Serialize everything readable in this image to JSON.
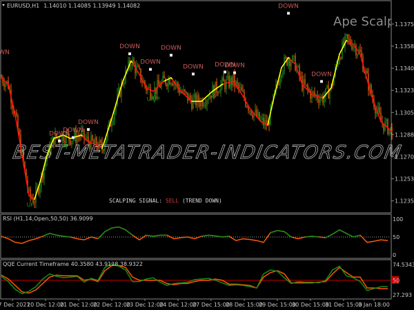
{
  "header": {
    "symbol": "EURUSD,H1",
    "ohlc": "1.14010 1.14085 1.13949 1.14082"
  },
  "indicator_title": "Ape Scalpin",
  "signal": {
    "prefix": "SCALPING SIGNAL: ",
    "value": "SELL",
    "suffix": " (TREND DOWN)"
  },
  "watermark": "BEST-METATRADER-INDICATORS.COM",
  "colors": {
    "bull": "#1f8a1f",
    "bear": "#e0600f",
    "trend_down": "#ff1010",
    "trend_up": "#ffff00",
    "down_label": "#c85a5a",
    "up_label": "#1f9a1f",
    "grid": "#8a8a8a"
  },
  "chart_data": [
    {
      "type": "candlestick",
      "title": "EURUSD,H1",
      "price_ticks": [
        "1.13755",
        "1.13580",
        "1.13405",
        "1.13230",
        "1.13055",
        "1.12880",
        "1.12705",
        "1.12530",
        "1.12355"
      ],
      "price_tick_values": [
        1.13755,
        1.1358,
        1.13405,
        1.1323,
        1.13055,
        1.1288,
        1.12705,
        1.1253,
        1.12355
      ],
      "ylim": [
        1.1226,
        1.1394
      ],
      "xlim": [
        0,
        283
      ],
      "time_ticks": [
        {
          "bar": 8,
          "label": "17 Dec 2021"
        },
        {
          "bar": 32,
          "label": "20 Dec 12:00"
        },
        {
          "bar": 56,
          "label": "21 Dec 12:00"
        },
        {
          "bar": 80,
          "label": "22 Dec 12:00"
        },
        {
          "bar": 104,
          "label": "23 Dec 12:00"
        },
        {
          "bar": 128,
          "label": "24 Dec 12:00"
        },
        {
          "bar": 152,
          "label": "27 Dec 15:00"
        },
        {
          "bar": 176,
          "label": "28 Dec 15:00"
        },
        {
          "bar": 200,
          "label": "29 Dec 15:00"
        },
        {
          "bar": 224,
          "label": "30 Dec 15:00"
        },
        {
          "bar": 248,
          "label": "31 Dec 15:00"
        },
        {
          "bar": 270,
          "label": "3 Jan 18:00"
        }
      ],
      "trend_line": {
        "bar": [
          0,
          5,
          10,
          15,
          20,
          24,
          28,
          33,
          38,
          45,
          50,
          58,
          63,
          70,
          73,
          80,
          88,
          94,
          100,
          105,
          110,
          118,
          123,
          130,
          138,
          145,
          153,
          160,
          168,
          173,
          180,
          188,
          193,
          198,
          203,
          208,
          213,
          218,
          225,
          233,
          239,
          245,
          250,
          255,
          260,
          268,
          275,
          283
        ],
        "price": [
          1.1333,
          1.13277,
          1.13036,
          1.12716,
          1.12395,
          1.12368,
          1.12502,
          1.12716,
          1.12849,
          1.12876,
          1.12849,
          1.12876,
          1.12823,
          1.12796,
          1.12769,
          1.13009,
          1.13303,
          1.13463,
          1.13356,
          1.1325,
          1.13223,
          1.13303,
          1.1333,
          1.13223,
          1.13143,
          1.13143,
          1.13223,
          1.13277,
          1.13303,
          1.13223,
          1.13089,
          1.12983,
          1.12956,
          1.13196,
          1.1341,
          1.1349,
          1.13437,
          1.13277,
          1.13196,
          1.13169,
          1.1325,
          1.13517,
          1.13624,
          1.13597,
          1.13517,
          1.13196,
          1.12983,
          1.12903
        ],
        "up_segments": [
          [
            24,
            58
          ],
          [
            73,
            94
          ],
          [
            118,
            123
          ],
          [
            138,
            160
          ],
          [
            193,
            208
          ],
          [
            233,
            250
          ]
        ]
      },
      "labels": [
        {
          "text": "WN",
          "bar": 2,
          "price": 1.13516,
          "kind": "down"
        },
        {
          "text": "DOWN",
          "bar": 42,
          "price": 1.12873,
          "kind": "down"
        },
        {
          "text": "DOWN",
          "bar": 52,
          "price": 1.129,
          "kind": "down"
        },
        {
          "text": "DOWN",
          "bar": 63,
          "price": 1.12964,
          "kind": "down"
        },
        {
          "text": "DOWN",
          "bar": 93,
          "price": 1.13563,
          "kind": "down"
        },
        {
          "text": "DOWN",
          "bar": 108,
          "price": 1.1344,
          "kind": "down"
        },
        {
          "text": "DOWN",
          "bar": 123,
          "price": 1.13552,
          "kind": "down"
        },
        {
          "text": "DOWN",
          "bar": 139,
          "price": 1.13403,
          "kind": "down"
        },
        {
          "text": "DOWN",
          "bar": 162,
          "price": 1.13419,
          "kind": "down"
        },
        {
          "text": "DOWN",
          "bar": 169,
          "price": 1.13413,
          "kind": "down"
        },
        {
          "text": "DOWN",
          "bar": 208,
          "price": 1.13884,
          "kind": "down"
        },
        {
          "text": "DOWN",
          "bar": 232,
          "price": 1.13344,
          "kind": "down"
        },
        {
          "text": "UP",
          "bar": 21,
          "price": 1.12309,
          "kind": "up"
        },
        {
          "text": "UP",
          "bar": 46,
          "price": 1.12773,
          "kind": "up"
        },
        {
          "text": "UP",
          "bar": 108,
          "price": 1.13146,
          "kind": "up"
        },
        {
          "text": "UP",
          "bar": 112,
          "price": 1.13146,
          "kind": "up"
        }
      ]
    },
    {
      "type": "line",
      "title": "RSI (H1,14,Open,50,50) 36.9099",
      "y_ticks": [
        "100",
        "50",
        "0"
      ],
      "ylim": [
        0,
        100
      ],
      "level": 50,
      "x_step_bars": 5,
      "series": [
        {
          "name": "RSI",
          "values": [
            52,
            45,
            35,
            32,
            40,
            45,
            52,
            60,
            55,
            52,
            50,
            45,
            42,
            50,
            45,
            65,
            75,
            78,
            70,
            55,
            42,
            55,
            52,
            55,
            55,
            45,
            48,
            50,
            45,
            52,
            55,
            53,
            50,
            52,
            40,
            45,
            43,
            40,
            35,
            62,
            68,
            65,
            50,
            45,
            50,
            52,
            50,
            48,
            58,
            70,
            60,
            50,
            55,
            35,
            38,
            42,
            40
          ]
        }
      ]
    },
    {
      "type": "line",
      "title": "QQE Current Timeframe 40.3580 43.9128 38.9322",
      "y_ticks": [
        "74.5343",
        "50",
        "27.293"
      ],
      "ylim": [
        27.293,
        74.5343
      ],
      "level": 50,
      "x_step_bars": 5,
      "series": [
        {
          "name": "QQE fast",
          "color": "#ff5a00",
          "values": [
            58,
            52,
            42,
            32,
            30,
            35,
            45,
            55,
            58,
            57,
            57,
            57,
            50,
            52,
            48,
            65,
            73,
            73,
            70,
            55,
            50,
            50,
            50,
            50,
            45,
            43,
            45,
            45,
            48,
            50,
            50,
            52,
            50,
            44,
            44,
            43,
            42,
            38,
            55,
            62,
            65,
            60,
            46,
            46,
            46,
            46,
            47,
            48,
            60,
            70,
            62,
            55,
            55,
            38,
            38,
            37,
            37
          ]
        },
        {
          "name": "QQE slow",
          "color": "#1a8a1a",
          "values": [
            56,
            48,
            36,
            29,
            33,
            40,
            52,
            60,
            56,
            54,
            55,
            56,
            47,
            53,
            50,
            70,
            76,
            72,
            66,
            48,
            48,
            52,
            54,
            47,
            42,
            45,
            46,
            47,
            51,
            52,
            53,
            50,
            46,
            42,
            43,
            42,
            40,
            38,
            60,
            66,
            64,
            54,
            45,
            48,
            47,
            47,
            46,
            50,
            66,
            72,
            57,
            54,
            48,
            34,
            37,
            40,
            40
          ]
        }
      ]
    }
  ]
}
